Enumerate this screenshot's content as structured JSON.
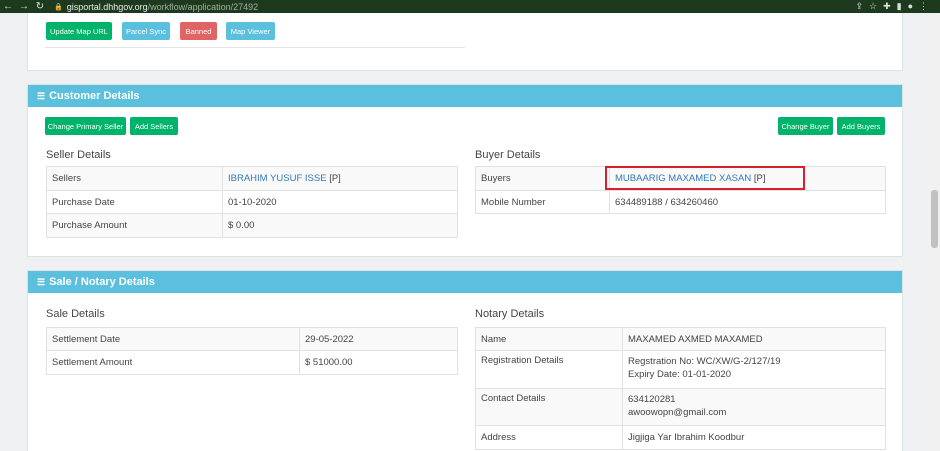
{
  "browser": {
    "url_domain": "gisportal.dhhgov.org",
    "url_path": "/workflow/application/27492"
  },
  "top_actions": {
    "update_map_url": "Update Map URL",
    "parcel_sync": "Parcel Sync",
    "banned": "Banned",
    "map_viewer": "Map Viewer"
  },
  "customer": {
    "title": "Customer Details",
    "change_primary_seller": "Change Primary Seller",
    "add_sellers": "Add Sellers",
    "change_buyer": "Change Buyer",
    "add_buyers": "Add Buyers",
    "seller_title": "Seller Details",
    "sellers_label": "Sellers",
    "sellers_name": "IBRAHIM YUSUF ISSE",
    "sellers_suffix": "[P]",
    "purchase_date_label": "Purchase Date",
    "purchase_date": "01-10-2020",
    "purchase_amount_label": "Purchase Amount",
    "purchase_amount": "$ 0.00",
    "buyer_title": "Buyer Details",
    "buyers_label": "Buyers",
    "buyers_name": "MUBAARIG MAXAMED XASAN",
    "buyers_suffix": "[P]",
    "mobile_label": "Mobile Number",
    "mobile": "634489188 / 634260460"
  },
  "sale": {
    "title": "Sale / Notary Details",
    "sale_title": "Sale Details",
    "settlement_date_label": "Settlement Date",
    "settlement_date": "29-05-2022",
    "settlement_amount_label": "Settlement Amount",
    "settlement_amount": "$ 51000.00",
    "notary_title": "Notary Details",
    "name_label": "Name",
    "name": "MAXAMED AXMED MAXAMED",
    "reg_label": "Registration Details",
    "reg_no": "Regstration No: WC/XW/G-2/127/19",
    "reg_expiry": "Expiry Date: 01-01-2020",
    "contact_label": "Contact Details",
    "contact_phone": "634120281",
    "contact_email": "awoowopn@gmail.com",
    "address_label": "Address",
    "address": "Jigjiga Yar Ibrahim Koodbur"
  }
}
